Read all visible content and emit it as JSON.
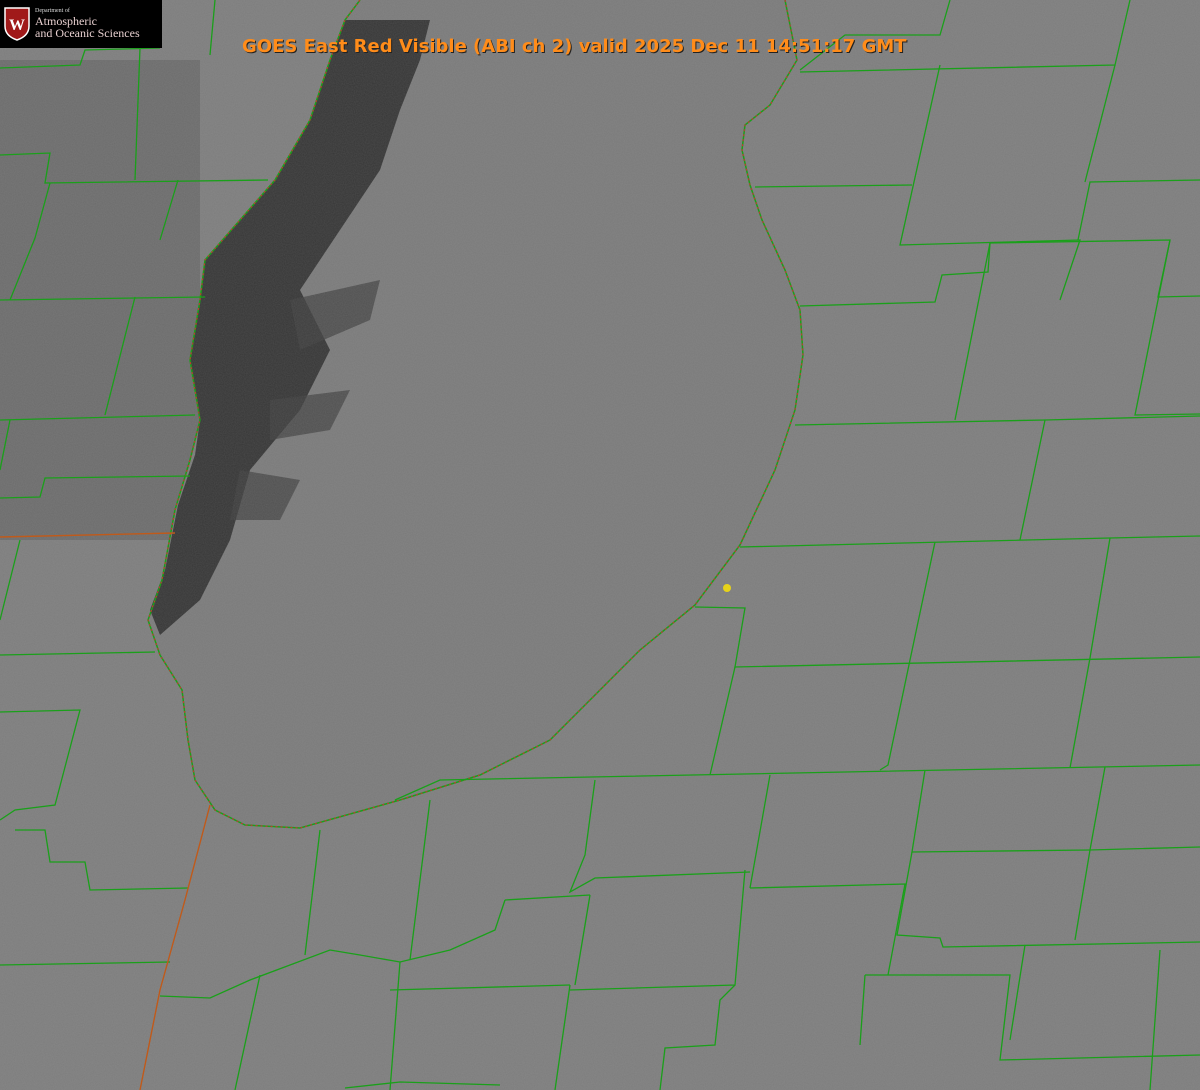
{
  "title": "GOES East Red Visible (ABI ch 2) valid 2025 Dec 11 14:51:17 GMT",
  "logo": {
    "department": "Department of",
    "line1": "Atmospheric",
    "line2": "and Oceanic Sciences",
    "seal_letter": "W"
  },
  "colors": {
    "land": "#7d7d7d",
    "lake_cloud": "#777777",
    "lake_dark": "#333333",
    "boundary": "#1aa01a",
    "state_line": "#c05a1a",
    "lake_outline": "#d03030",
    "station_dot": "#e6d21a",
    "title": "#ff8c1a",
    "logo_seal": "#a01a1a"
  },
  "icons": {
    "seal": "uw-crest-icon",
    "station": "station-dot-icon"
  }
}
